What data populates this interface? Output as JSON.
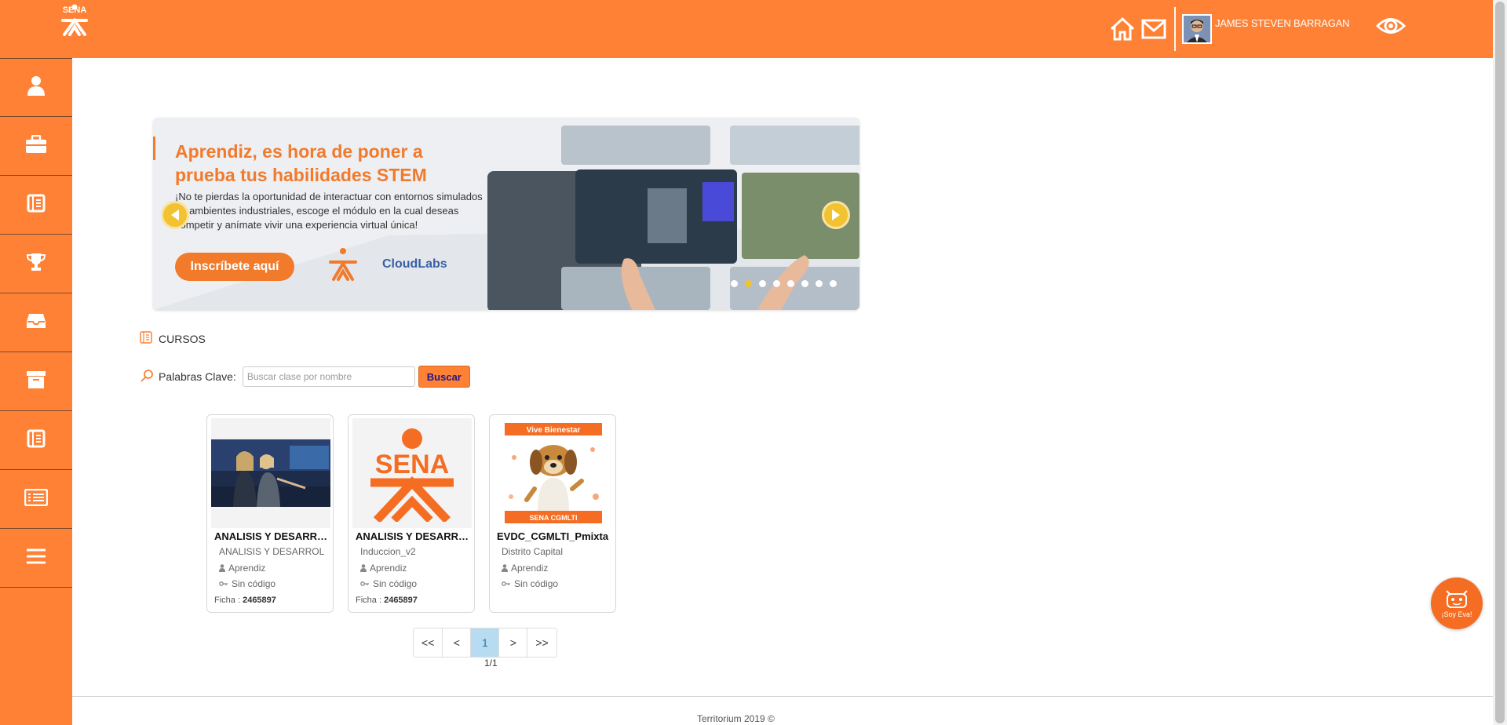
{
  "header": {
    "user_name": "JAMES STEVEN BARRAGAN",
    "icons": [
      "home-icon",
      "mail-icon",
      "eye-icon"
    ],
    "logo_text": "SENA"
  },
  "sidebar": {
    "items": [
      {
        "icon": "user-icon"
      },
      {
        "icon": "briefcase-icon"
      },
      {
        "icon": "book-icon"
      },
      {
        "icon": "trophy-icon"
      },
      {
        "icon": "inbox-icon"
      },
      {
        "icon": "archive-icon"
      },
      {
        "icon": "book-icon"
      },
      {
        "icon": "list-icon"
      },
      {
        "icon": "menu-icon"
      }
    ]
  },
  "banner": {
    "title": "Aprendiz, es hora de poner a prueba tus habilidades STEM",
    "text": "¡No te pierdas la oportunidad de interactuar con entornos simulados en ambientes industriales, escoge el módulo en la cual deseas competir y anímate vivir una experiencia virtual única!",
    "cta": "Inscríbete aquí",
    "partner": "CloudLabs",
    "slide_count": 8,
    "active_slide": 2
  },
  "section": {
    "title": "CURSOS"
  },
  "search": {
    "label": "Palabras Clave:",
    "placeholder": "Buscar clase por nombre",
    "button": "Buscar"
  },
  "courses": [
    {
      "title": "ANALISIS Y DESARROLLO DE SOFTWARE",
      "subtitle": "ANALISIS Y DESARROLLO DE SOFTWARE",
      "role": "Aprendiz",
      "code": "Sin código",
      "ficha_label": "Ficha :",
      "ficha": "2465897",
      "image": "photo"
    },
    {
      "title": "ANALISIS Y DESARROLLO DE SOFTWARE",
      "subtitle": "Induccion_v2",
      "role": "Aprendiz",
      "code": "Sin código",
      "ficha_label": "Ficha :",
      "ficha": "2465897",
      "image": "sena-logo"
    },
    {
      "title": "EVDC_CGMLTI_Pmixta",
      "subtitle": "Distrito Capital",
      "role": "Aprendiz",
      "code": "Sin código",
      "image": "bienestar",
      "image_banner_top": "Vive Bienestar",
      "image_banner_bottom": "SENA CGMLTI"
    }
  ],
  "pagination": {
    "first": "<<",
    "prev": "<",
    "current": "1",
    "next": ">",
    "last": ">>",
    "indicator": "1/1"
  },
  "footer": {
    "text": "Territorium 2019 ©"
  },
  "assistant": {
    "label": "¡Soy Eva!"
  },
  "colors": {
    "primary": "#fe8135",
    "accent_yellow": "#f2c230",
    "active_page": "#b7dbf1"
  }
}
